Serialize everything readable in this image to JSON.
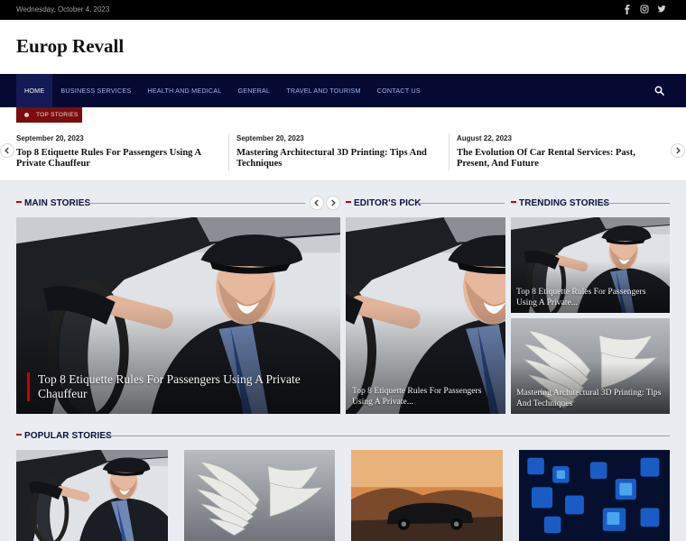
{
  "topbar": {
    "date": "Wednesday, October 4, 2023",
    "social": [
      "facebook-icon",
      "instagram-icon",
      "twitter-icon"
    ]
  },
  "site": {
    "title": "Europ Revall"
  },
  "nav": {
    "items": [
      {
        "label": "HOME",
        "active": true
      },
      {
        "label": "BUSINESS SERVICES"
      },
      {
        "label": "HEALTH AND MEDICAL"
      },
      {
        "label": "GENERAL"
      },
      {
        "label": "TRAVEL AND TOURISM"
      },
      {
        "label": "CONTACT US"
      }
    ],
    "search_icon": "search-icon"
  },
  "top_stories": {
    "badge": "TOP STORIES",
    "items": [
      {
        "date": "September 20, 2023",
        "title": "Top 8 Etiquette Rules For Passengers Using A Private Chauffeur"
      },
      {
        "date": "September 20, 2023",
        "title": "Mastering Architectural 3D Printing: Tips And Techniques"
      },
      {
        "date": "August 22, 2023",
        "title": "The Evolution Of Car Rental Services: Past, Present, And Future"
      }
    ]
  },
  "sections": {
    "main": {
      "title": "MAIN STORIES",
      "feature": "Top 8 Etiquette Rules For Passengers Using A Private Chauffeur"
    },
    "editors": {
      "title": "EDITOR'S PICK",
      "feature": "Top 8 Etiquette Rules For Passengers Using A Private..."
    },
    "trending": {
      "title": "TRENDING STORIES",
      "items": [
        "Top 8 Etiquette Rules For Passengers Using A Private...",
        "Mastering Architectural 3D Printing: Tips And Techniques"
      ]
    },
    "popular": {
      "title": "POPULAR STORIES"
    }
  },
  "colors": {
    "nav_bg": "#060a33",
    "accent_red": "#c00000",
    "badge_bg": "#7a0d0d"
  }
}
